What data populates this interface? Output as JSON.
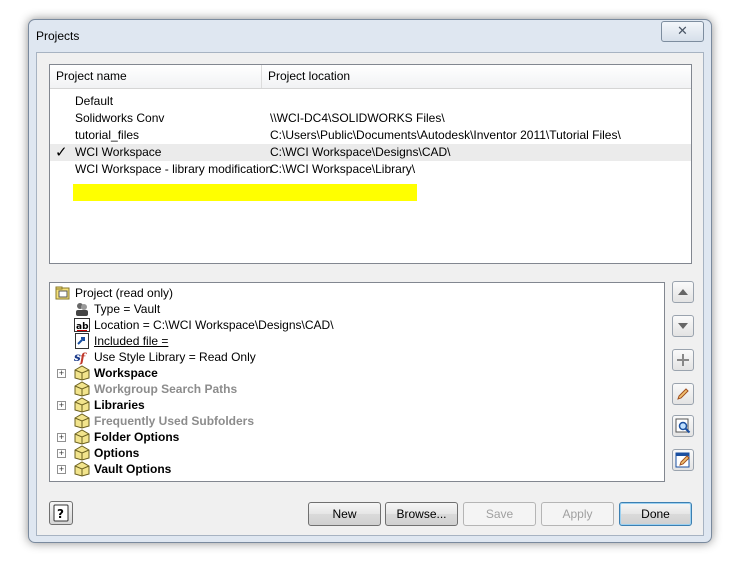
{
  "window": {
    "title": "Projects",
    "close_label": "✕"
  },
  "project_list": {
    "columns": [
      "Project name",
      "Project location"
    ],
    "rows": [
      {
        "name": "Default",
        "location": "",
        "active": false
      },
      {
        "name": "Solidworks Conv",
        "location": "\\\\WCI-DC4\\SOLIDWORKS Files\\",
        "active": false
      },
      {
        "name": "tutorial_files",
        "location": "C:\\Users\\Public\\Documents\\Autodesk\\Inventor 2011\\Tutorial Files\\",
        "active": false
      },
      {
        "name": "WCI Workspace",
        "location": "C:\\WCI Workspace\\Designs\\CAD\\",
        "active": true
      },
      {
        "name": "WCI Workspace - library modification",
        "location": "C:\\WCI Workspace\\Library\\",
        "active": false
      }
    ],
    "active_mark": "✓",
    "highlight_color": "#ffff00"
  },
  "tree": {
    "root": "Project (read only)",
    "details": [
      "Type = Vault",
      "Location = C:\\WCI Workspace\\Designs\\CAD\\",
      "Included file =",
      "Use Style Library = Read Only"
    ],
    "sections": [
      {
        "label": "Workspace",
        "expandable": true,
        "enabled": true
      },
      {
        "label": "Workgroup Search Paths",
        "expandable": false,
        "enabled": false
      },
      {
        "label": "Libraries",
        "expandable": true,
        "enabled": true
      },
      {
        "label": "Frequently Used Subfolders",
        "expandable": false,
        "enabled": false
      },
      {
        "label": "Folder Options",
        "expandable": true,
        "enabled": true
      },
      {
        "label": "Options",
        "expandable": true,
        "enabled": true
      },
      {
        "label": "Vault Options",
        "expandable": true,
        "enabled": true
      }
    ],
    "expander_symbol": "+"
  },
  "side_buttons": [
    "move-up-icon",
    "move-down-icon",
    "add-icon",
    "edit-pencil-icon",
    "find-icon",
    "edit-document-icon"
  ],
  "buttons": {
    "new": "New",
    "browse": "Browse...",
    "save": "Save",
    "apply": "Apply",
    "done": "Done",
    "help_icon": "help-question-icon"
  }
}
